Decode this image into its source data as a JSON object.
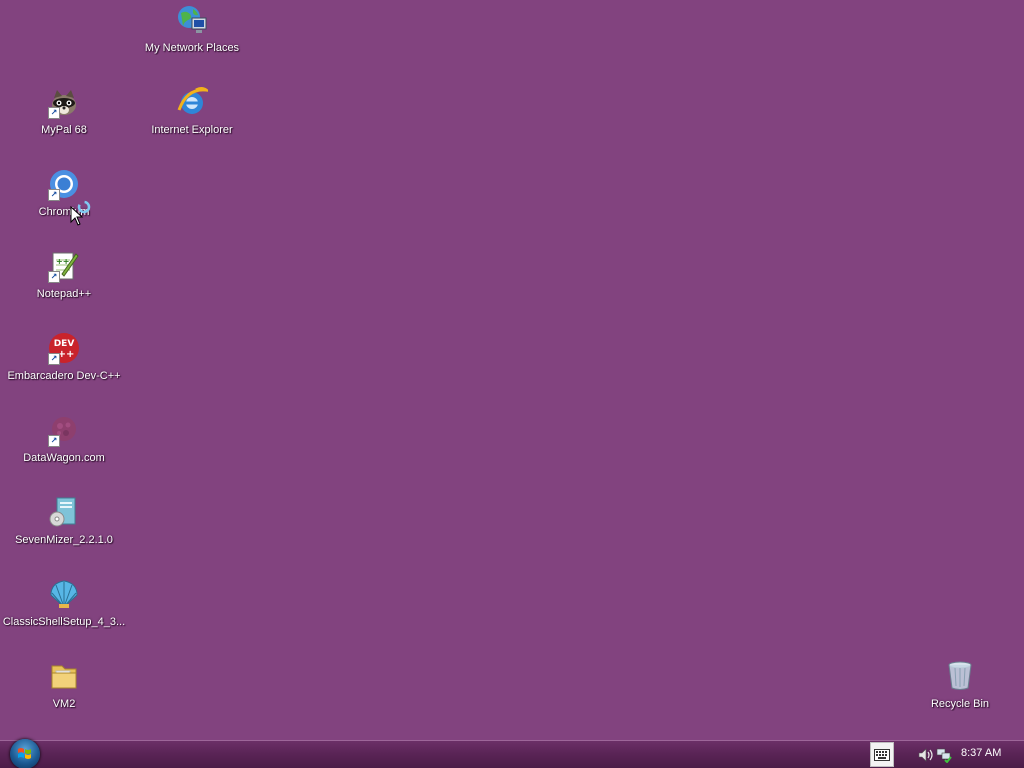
{
  "desktop": {
    "background_color": "#82437f",
    "icons": [
      {
        "id": "my-network-places",
        "label": "My Network Places",
        "icon": "network-places-icon",
        "shortcut": false
      },
      {
        "id": "mypal",
        "label": "MyPal 68",
        "icon": "mypal-raccoon-icon",
        "shortcut": true
      },
      {
        "id": "internet-explorer",
        "label": "Internet Explorer",
        "icon": "internet-explorer-icon",
        "shortcut": false
      },
      {
        "id": "chromium",
        "label": "Chromium",
        "icon": "chromium-icon",
        "shortcut": true
      },
      {
        "id": "notepad-plus-plus",
        "label": "Notepad++",
        "icon": "notepad-plus-plus-icon",
        "shortcut": true
      },
      {
        "id": "dev-cpp",
        "label": "Embarcadero Dev-C++",
        "icon": "dev-cpp-icon",
        "shortcut": true
      },
      {
        "id": "datawagon",
        "label": "DataWagon.com",
        "icon": "datawagon-icon",
        "shortcut": true
      },
      {
        "id": "sevenmizer",
        "label": "SevenMizer_2.2.1.0",
        "icon": "sevenmizer-installer-icon",
        "shortcut": false
      },
      {
        "id": "classicshell",
        "label": "ClassicShellSetup_4_3...",
        "icon": "classic-shell-icon",
        "shortcut": false
      },
      {
        "id": "vm2",
        "label": "VM2",
        "icon": "folder-icon",
        "shortcut": false
      },
      {
        "id": "recycle-bin",
        "label": "Recycle Bin",
        "icon": "recycle-bin-icon",
        "shortcut": false
      }
    ]
  },
  "taskbar": {
    "start_icon": "windows-start-orb-icon",
    "tray": {
      "keyboard_icon": "on-screen-keyboard-icon",
      "volume_icon": "speaker-volume-icon",
      "network_icon": "network-status-icon",
      "clock": "8:37 AM"
    }
  }
}
